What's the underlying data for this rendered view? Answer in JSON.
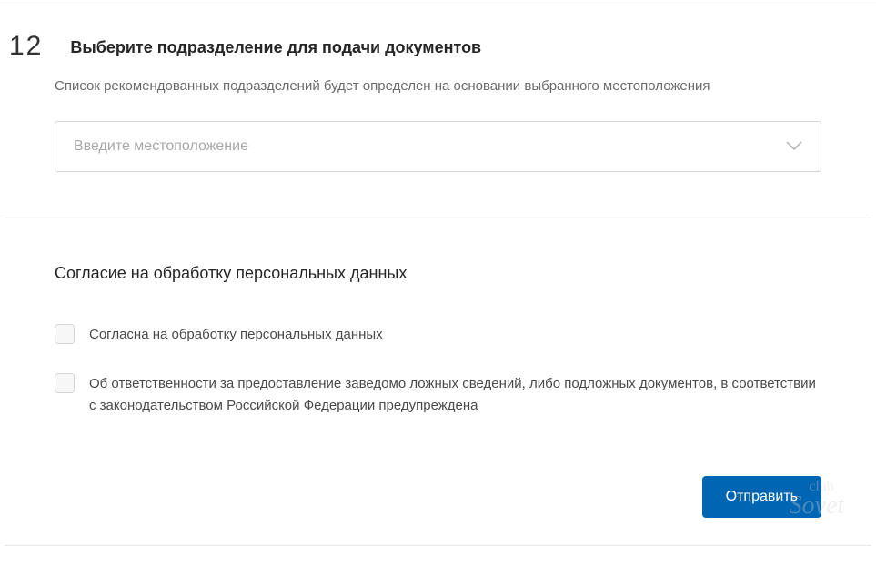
{
  "step": {
    "number": "12",
    "title": "Выберите подразделение для подачи документов",
    "description": "Список рекомендованных подразделений будет определен на основании выбранного местоположения"
  },
  "location_select": {
    "placeholder": "Введите местоположение"
  },
  "consent": {
    "title": "Согласие на обработку персональных данных",
    "checkbox1_label": "Согласна на обработку персональных данных",
    "checkbox2_label": "Об ответственности за предоставление заведомо ложных сведений, либо подложных документов, в соответствии с законодательством Российской Федерации предупреждена"
  },
  "submit_label": "Отправить",
  "watermark": {
    "line1": "club",
    "line2": "Sovet"
  }
}
